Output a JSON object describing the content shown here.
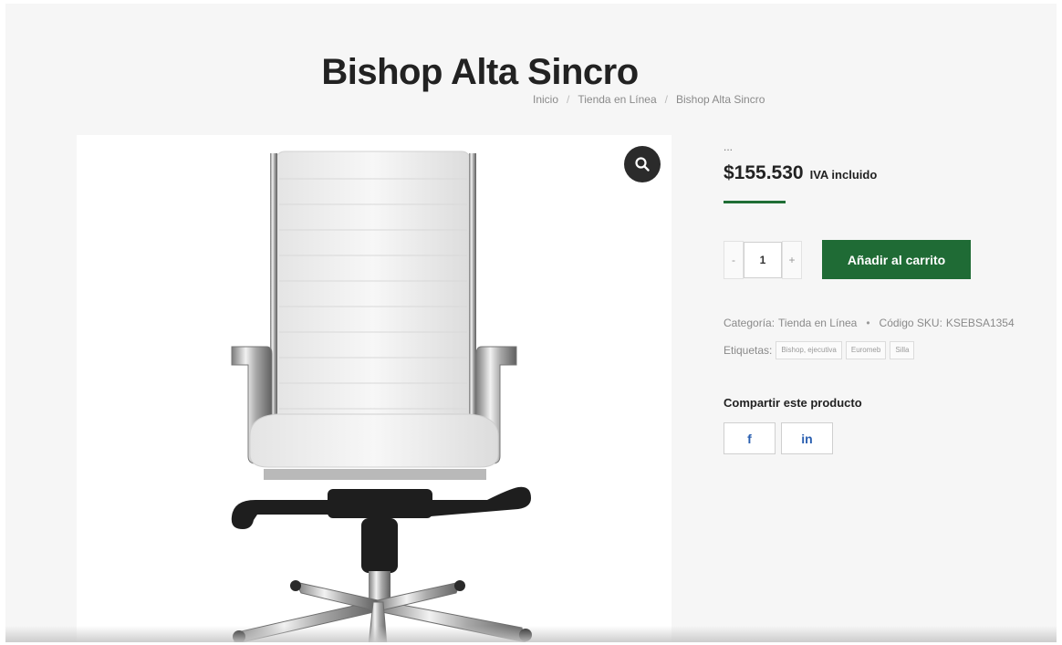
{
  "product": {
    "title": "Bishop Alta Sincro",
    "price": "$155.530",
    "price_suffix": "IVA incluido",
    "dots": "..."
  },
  "breadcrumb": {
    "home": "Inicio",
    "shop": "Tienda en Línea",
    "current": "Bishop Alta Sincro",
    "separator": "/"
  },
  "cart": {
    "quantity": "1",
    "minus": "-",
    "plus": "+",
    "add_label": "Añadir al carrito"
  },
  "meta": {
    "category_label": "Categoría:",
    "category_value": "Tienda en Línea",
    "bullet": "•",
    "sku_label": "Código SKU:",
    "sku_value": "KSEBSA1354"
  },
  "tags": {
    "label": "Etiquetas:",
    "items": [
      "Bishop, ejecutiva",
      "Euromeb",
      "Silla"
    ]
  },
  "share": {
    "title": "Compartir este producto",
    "facebook": "f",
    "linkedin": "in"
  },
  "colors": {
    "accent_green": "#1f6b35",
    "share_icon_blue": "#2a5fb0"
  },
  "icons": {
    "zoom": "search-icon",
    "facebook": "facebook-icon",
    "linkedin": "linkedin-icon"
  }
}
